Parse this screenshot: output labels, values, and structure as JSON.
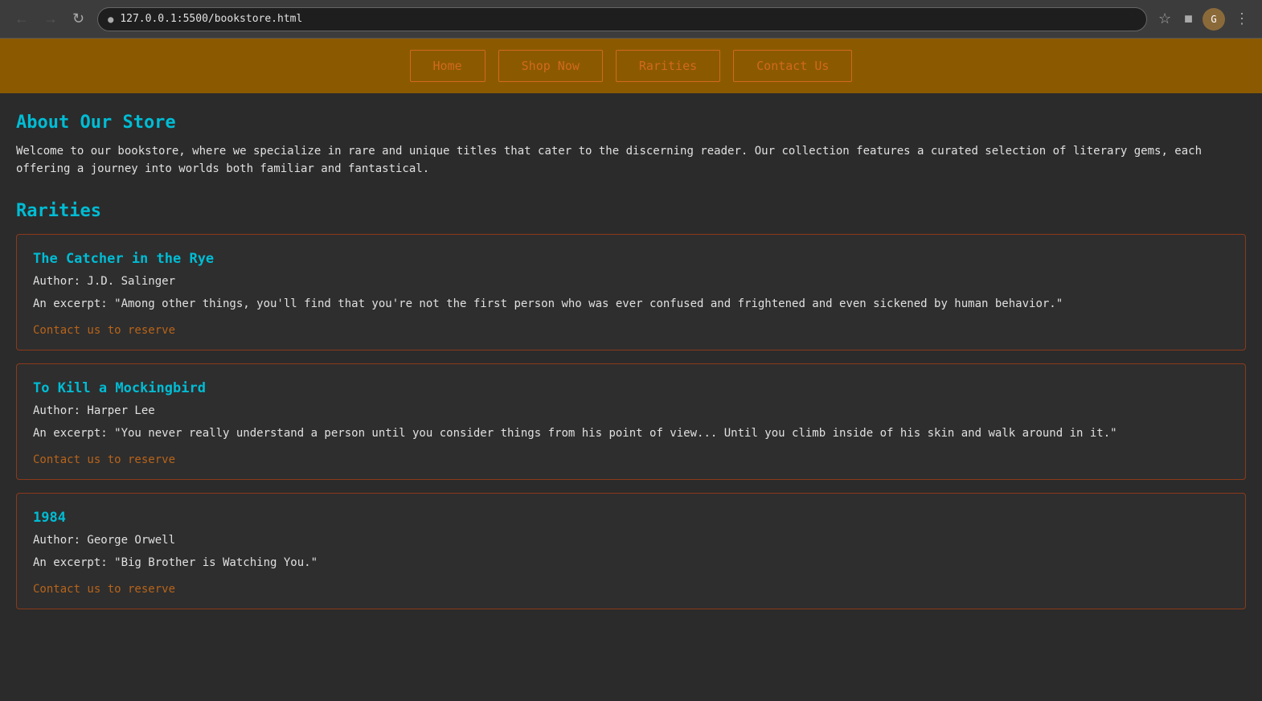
{
  "browser": {
    "back_disabled": true,
    "forward_disabled": true,
    "url": "127.0.0.1:5500/bookstore.html",
    "full_url": "127.0.0.1:5500/bookstore.html"
  },
  "navbar": {
    "links": [
      {
        "id": "home",
        "label": "Home"
      },
      {
        "id": "shop-now",
        "label": "Shop Now"
      },
      {
        "id": "rarities",
        "label": "Rarities"
      },
      {
        "id": "contact-us",
        "label": "Contact Us"
      }
    ]
  },
  "about": {
    "title": "About Our Store",
    "text": "Welcome to our bookstore, where we specialize in rare and unique titles that cater to the discerning reader. Our collection features a curated selection of literary gems, each offering a journey into worlds both familiar and fantastical."
  },
  "rarities": {
    "title": "Rarities",
    "books": [
      {
        "id": "catcher",
        "title": "The Catcher in the Rye",
        "author": "Author: J.D. Salinger",
        "excerpt": "An excerpt: \"Among other things, you'll find that you're not the first person who was ever confused and frightened and even sickened by human behavior.\"",
        "reserve_label": "Contact us to reserve"
      },
      {
        "id": "mockingbird",
        "title": "To Kill a Mockingbird",
        "author": "Author: Harper Lee",
        "excerpt": "An excerpt: \"You never really understand a person until you consider things from his point of view... Until you climb inside of his skin and walk around in it.\"",
        "reserve_label": "Contact us to reserve"
      },
      {
        "id": "1984",
        "title": "1984",
        "author": "Author: George Orwell",
        "excerpt": "An excerpt: \"Big Brother is Watching You.\"",
        "reserve_label": "Contact us to reserve"
      }
    ]
  }
}
